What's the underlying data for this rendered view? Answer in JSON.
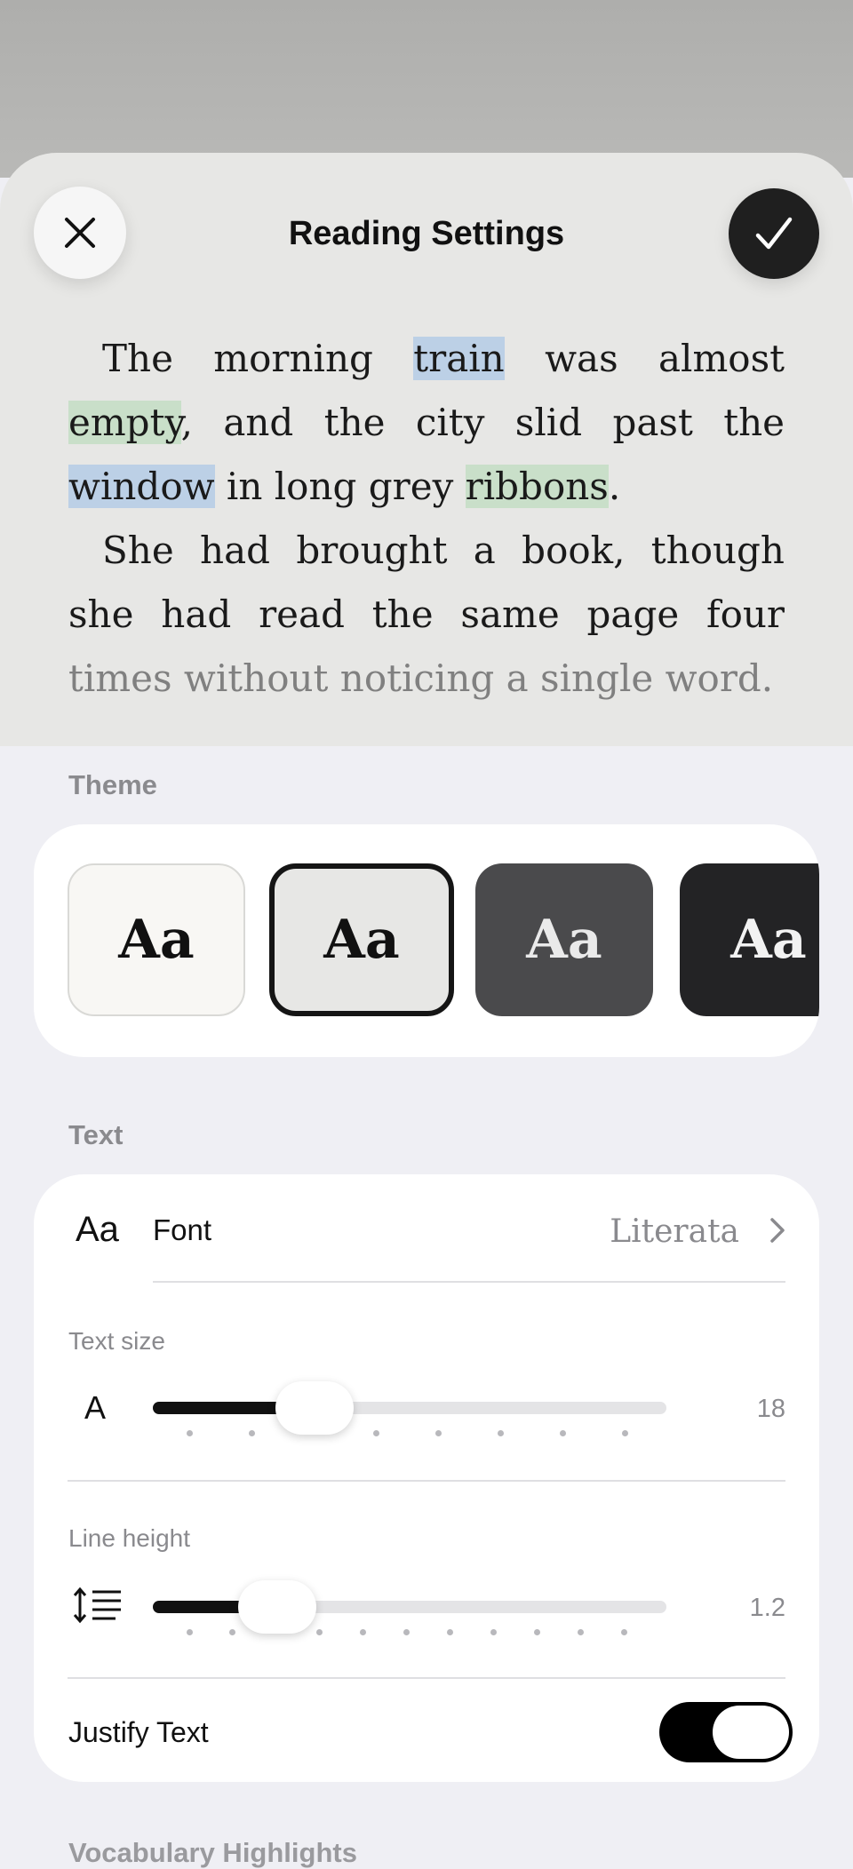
{
  "header": {
    "title": "Reading Settings",
    "close_icon": "close-icon",
    "done_icon": "checkmark-icon"
  },
  "preview": {
    "p1": {
      "t1": "The morning ",
      "h1": "train",
      "t2": " was almost ",
      "h2": "empty",
      "t3": ", and the city slid past the ",
      "h3": "window",
      "t4": " in long grey ",
      "h4": "ribbons",
      "t5": "."
    },
    "p2": {
      "t1": "She had brought a book, though she had read the same page four ",
      "faded": "times without noticing a single word."
    },
    "highlight_colors": {
      "blue": "#bcd0e6",
      "green": "#c9dfc9"
    }
  },
  "theme": {
    "label": "Theme",
    "options": [
      {
        "label": "Aa",
        "background": "#f8f7f4",
        "selected": false
      },
      {
        "label": "Aa",
        "background": "#e7e7e5",
        "selected": true
      },
      {
        "label": "Aa",
        "background": "#4a4a4c",
        "selected": false
      },
      {
        "label": "Aa",
        "background": "#232325",
        "selected": false
      }
    ]
  },
  "text": {
    "label": "Text",
    "font": {
      "icon_text": "Aa",
      "label": "Font",
      "value": "Literata"
    },
    "text_size": {
      "label": "Text size",
      "icon_text": "A",
      "value": "18"
    },
    "line_height": {
      "label": "Line height",
      "icon": "line-height-icon",
      "value": "1.2"
    },
    "justify": {
      "label": "Justify Text",
      "on": true
    }
  },
  "next_section": {
    "label": "Vocabulary Highlights"
  }
}
